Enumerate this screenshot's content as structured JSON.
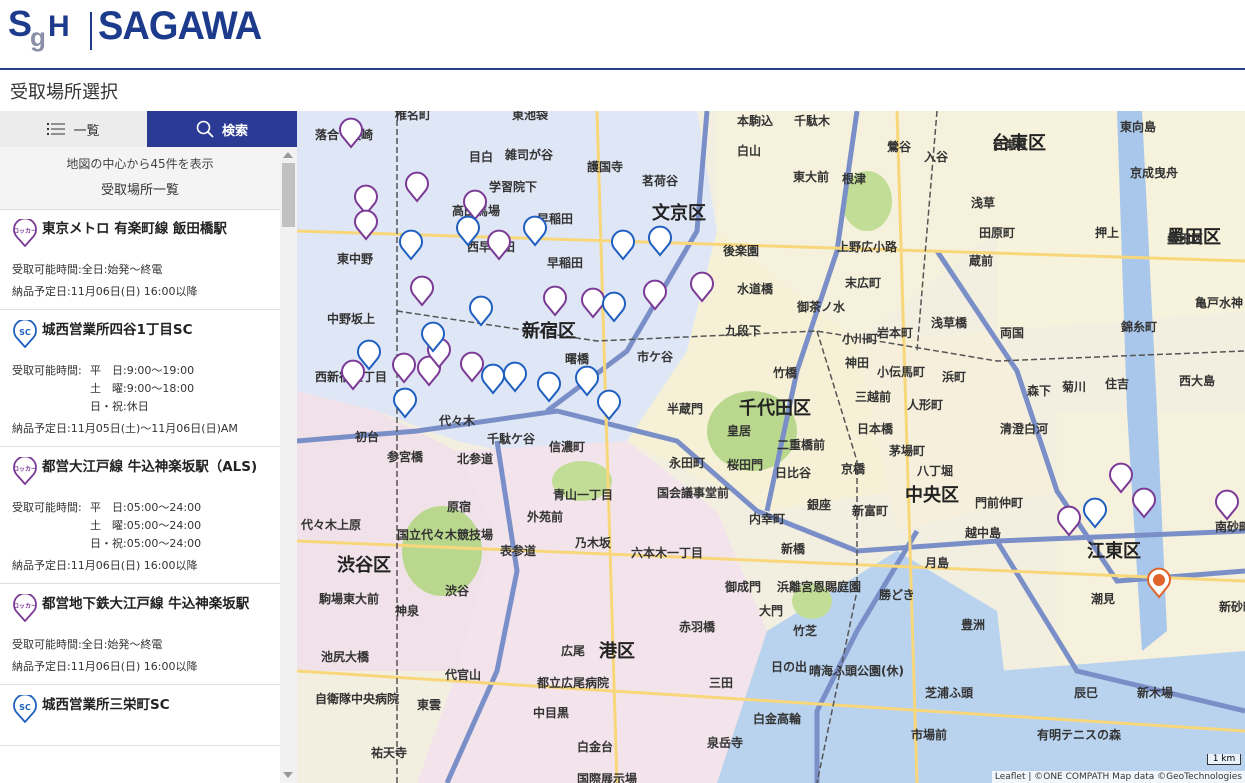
{
  "header": {
    "logo_mark": "SgH",
    "logo_text": "SAGAWA"
  },
  "page_title": "受取場所選択",
  "tabs": {
    "list_label": "一覧",
    "search_label": "検索"
  },
  "list_header": {
    "center_info": "地図の中心から45件を表示",
    "list_title": "受取場所一覧"
  },
  "items": [
    {
      "type": "locker",
      "icon_text": "ロッカー",
      "name": "東京メトロ 有楽町線 飯田橋駅",
      "hours_label": "受取可能時間:",
      "hours": "全日:始発～終電",
      "delivery": "納品予定日:11月06日(日) 16:00以降"
    },
    {
      "type": "sc",
      "icon_text": "SC",
      "name": "城西営業所四谷1丁目SC",
      "hours_label": "受取可能時間:",
      "hours_rows": [
        [
          "平　日:",
          "9:00～19:00"
        ],
        [
          "土　曜:",
          "9:00～18:00"
        ],
        [
          "日・祝:",
          "休日"
        ]
      ],
      "delivery": "納品予定日:11月05日(土)～11月06日(日)AM"
    },
    {
      "type": "locker",
      "icon_text": "ロッカー",
      "name": "都営大江戸線 牛込神楽坂駅（ALS)",
      "hours_label": "受取可能時間:",
      "hours_rows": [
        [
          "平　日:",
          "05:00～24:00"
        ],
        [
          "土　曜:",
          "05:00～24:00"
        ],
        [
          "日・祝:",
          "05:00～24:00"
        ]
      ],
      "delivery": "納品予定日:11月06日(日) 16:00以降"
    },
    {
      "type": "locker",
      "icon_text": "ロッカー",
      "name": "都営地下鉄大江戸線 牛込神楽坂駅",
      "hours_label": "受取可能時間:",
      "hours": "全日:始発～終電",
      "delivery": "納品予定日:11月06日(日) 16:00以降"
    },
    {
      "type": "sc",
      "icon_text": "SC",
      "name": "城西営業所三栄町SC"
    }
  ],
  "map": {
    "wards": [
      "文京区",
      "台東区",
      "墨田区",
      "新宿区",
      "千代田区",
      "中央区",
      "江東区",
      "渋谷区",
      "港区"
    ],
    "places": [
      "落合",
      "長崎",
      "椎名町",
      "東池袋",
      "護国寺",
      "本駒込",
      "千駄木",
      "台東区",
      "東向島",
      "目白",
      "雑司が谷",
      "茗荷谷",
      "白山",
      "鶯谷",
      "入谷",
      "京成曳舟",
      "高田馬場",
      "学習院下",
      "早稲田",
      "東大前",
      "根津",
      "浅草",
      "押上",
      "東中野",
      "西早稲田",
      "早稲田",
      "後楽園",
      "上野広小路",
      "田原町",
      "墨田区",
      "中野坂上",
      "水道橋",
      "末広町",
      "蔵前",
      "亀戸水神",
      "御茶ノ水",
      "錦糸町",
      "九段下",
      "小川町",
      "岩本町",
      "浅草橋",
      "両国",
      "曙橋",
      "市ケ谷",
      "神田",
      "小伝馬町",
      "森下",
      "菊川",
      "住吉",
      "西大島",
      "竹橋",
      "三越前",
      "人形町",
      "浜町",
      "西新宿五丁目",
      "半蔵門",
      "日本橋",
      "清澄白河",
      "初台",
      "代々木",
      "千駄ケ谷",
      "信濃町",
      "皇居",
      "二重橋前",
      "茅場町",
      "参宮橋",
      "北参道",
      "永田町",
      "桜田門",
      "日比谷",
      "京橋",
      "八丁堀",
      "門前仲町",
      "国会議事堂前",
      "銀座",
      "新富町",
      "青山一丁目",
      "原宿",
      "外苑前",
      "内幸町",
      "越中島",
      "南砂町",
      "代々木上原",
      "国立代々木競技場",
      "乃木坂",
      "新橋",
      "六本木一丁目",
      "月島",
      "表参道",
      "渋谷",
      "御成門",
      "浜離宮恩賜庭園",
      "勝どき",
      "豊洲",
      "潮見",
      "駒場東大前",
      "神泉",
      "赤羽橋",
      "大門",
      "竹芝",
      "新砂町",
      "池尻大橋",
      "代官山",
      "広尾",
      "日の出",
      "晴海ふ頭公園(休)",
      "辰巳",
      "新木場",
      "自衛隊中央病院",
      "都立広尾病院",
      "三田",
      "芝浦ふ頭",
      "市場前",
      "有明テニスの森",
      "東雲",
      "中目黒",
      "白金高輪",
      "祐天寺",
      "白金台",
      "泉岳寺",
      "国際展示場"
    ],
    "attribution": "Leaflet | ©ONE COMPATH Map data ©GeoTechnologies",
    "scale_label": "1 km"
  },
  "colors": {
    "brand": "#1c3b8c",
    "tab_active": "#2b3b95",
    "locker_pin": "#7b3a96",
    "sc_pin": "#1f5fbf",
    "shinjuku_fill": "#dfe6f5"
  }
}
